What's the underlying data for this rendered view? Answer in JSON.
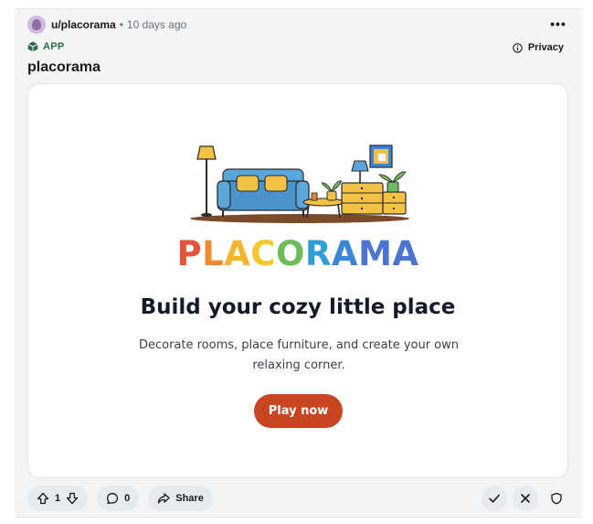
{
  "post": {
    "username": "u/placorama",
    "separator": "•",
    "timestamp": "10 days ago",
    "more_label": "•••",
    "app_badge": "APP",
    "privacy_label": "Privacy",
    "title": "placorama"
  },
  "app": {
    "logo": [
      {
        "char": "P",
        "color": "#e5533a"
      },
      {
        "char": "L",
        "color": "#f08a2e"
      },
      {
        "char": "A",
        "color": "#f3b62e"
      },
      {
        "char": "C",
        "color": "#f3c72e"
      },
      {
        "char": "O",
        "color": "#6dbb5b"
      },
      {
        "char": "R",
        "color": "#2f9ed7"
      },
      {
        "char": "A",
        "color": "#3c86d8"
      },
      {
        "char": "M",
        "color": "#4b74d4"
      },
      {
        "char": "A",
        "color": "#4b74d4"
      }
    ],
    "headline": "Build your cozy little place",
    "subtext": "Decorate rooms, place furniture, and create your own relaxing corner.",
    "cta": "Play now",
    "accent": "#c8451f"
  },
  "actions": {
    "upvote_icon": "arrow-up-icon",
    "vote_count": "1",
    "downvote_icon": "arrow-down-icon",
    "comment_icon": "comment-icon",
    "comment_count": "0",
    "share_icon": "share-icon",
    "share_label": "Share",
    "approve_icon": "check-icon",
    "remove_icon": "close-icon",
    "mod_icon": "shield-icon"
  }
}
